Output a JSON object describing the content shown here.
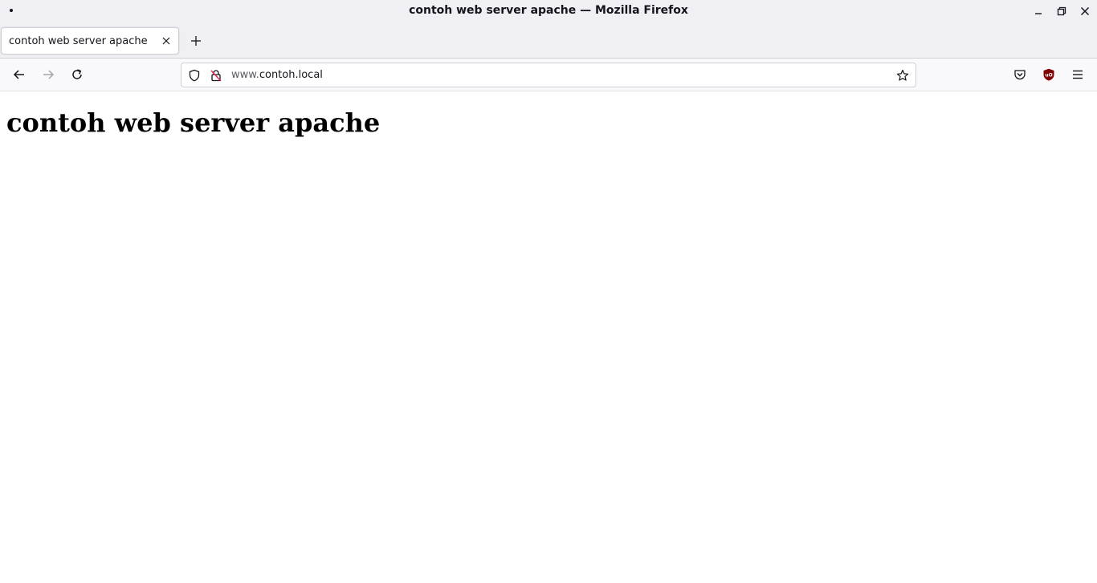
{
  "window": {
    "title": "contoh web server apache — Mozilla Firefox",
    "controls": {
      "minimize_icon": "minimize-icon",
      "restore_icon": "restore-icon",
      "close_icon": "close-icon"
    }
  },
  "tabs": [
    {
      "label": "contoh web server apache",
      "active": true
    }
  ],
  "toolbar": {
    "back_icon": "back-arrow-icon",
    "forward_icon": "forward-arrow-icon",
    "reload_icon": "reload-icon",
    "url": {
      "prefix": "www.",
      "host": "contoh.local"
    },
    "extensions": [
      "pocket-icon",
      "ublock-origin-icon"
    ],
    "menu_icon": "hamburger-menu-icon"
  },
  "page": {
    "heading": "contoh web server apache"
  },
  "colors": {
    "chrome_bg": "#f0f0f4",
    "toolbar_bg": "#f9f9fb",
    "ublock_red": "#800000"
  }
}
